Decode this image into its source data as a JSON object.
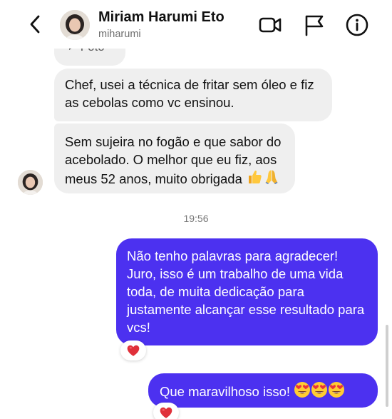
{
  "header": {
    "name": "Miriam Harumi Eto",
    "username": "miharumi",
    "icons": [
      "back-chevron-icon",
      "video-call-icon",
      "flag-icon",
      "info-icon"
    ]
  },
  "conversation": {
    "partial_label": "Foto",
    "messages": [
      {
        "side": "in",
        "text": "Chef, usei a técnica de fritar sem óleo e fiz as cebolas como vc ensinou."
      },
      {
        "side": "in",
        "text": "Sem sujeira no fogão e que sabor do acebolado. O melhor que eu fiz, aos meus 52 anos, muito obrigada",
        "emojis": [
          "thumbs-up",
          "folded-hands"
        ]
      },
      {
        "side": "out",
        "text": "Não tenho palavras para agradecer! Juro, isso é um trabalho de uma vida toda, de muita dedicação para justamente alcançar esse resultado para vcs!",
        "reaction": "red-heart"
      },
      {
        "side": "out",
        "text": "Que maravilhoso isso!",
        "emojis": [
          "heart-eyes",
          "heart-eyes",
          "heart-eyes"
        ],
        "reaction": "red-heart"
      }
    ],
    "timestamp": "19:56"
  },
  "colors": {
    "outgoing_bubble": "#4c31f0",
    "incoming_bubble": "#efefef",
    "reaction_heart": "#e0303a"
  }
}
